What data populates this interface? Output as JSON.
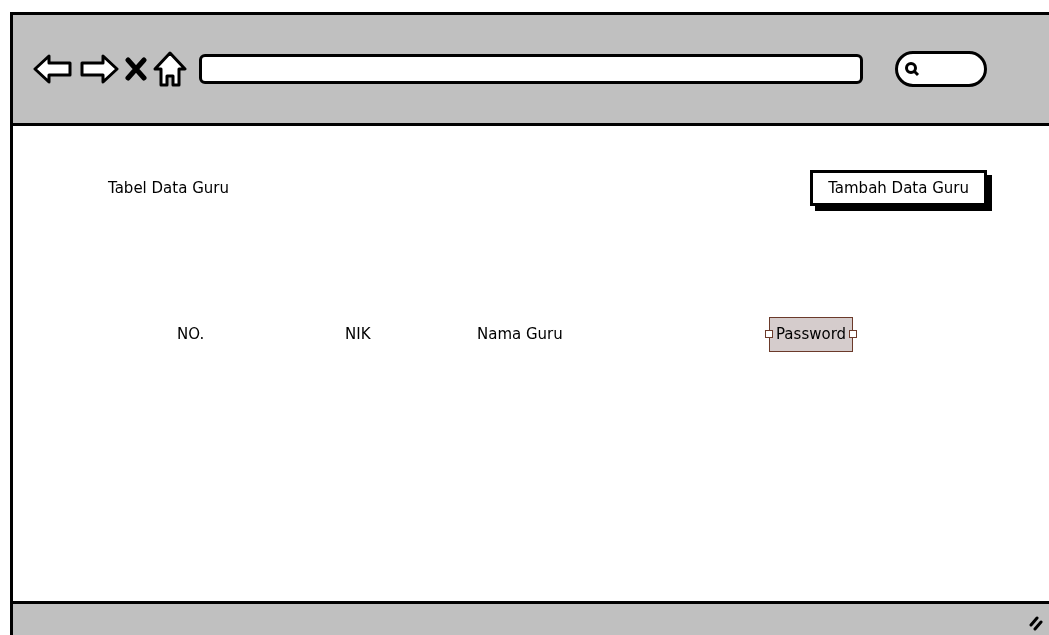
{
  "page": {
    "title": "Tabel Data Guru",
    "add_button": "Tambah Data Guru"
  },
  "table": {
    "columns": [
      {
        "label": "NO.",
        "selected": false
      },
      {
        "label": "NIK",
        "selected": false
      },
      {
        "label": "Nama Guru",
        "selected": false
      },
      {
        "label": "Password",
        "selected": true
      }
    ]
  }
}
